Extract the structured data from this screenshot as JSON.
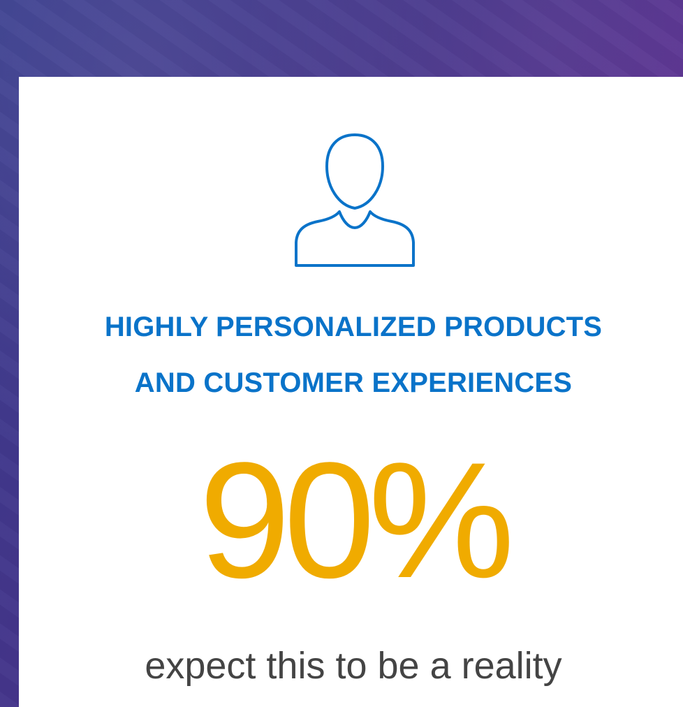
{
  "card": {
    "icon": "user-outline-icon",
    "headline_line1": "HIGHLY PERSONALIZED PRODUCTS",
    "headline_line2": "AND CUSTOMER EXPERIENCES",
    "stat_value": "90%",
    "caption_line1": "expect this to be a reality"
  },
  "colors": {
    "headline": "#0a73c9",
    "stat": "#f0ab00",
    "caption": "#444444",
    "icon_stroke": "#0a73c9",
    "background": "#4a3490"
  }
}
